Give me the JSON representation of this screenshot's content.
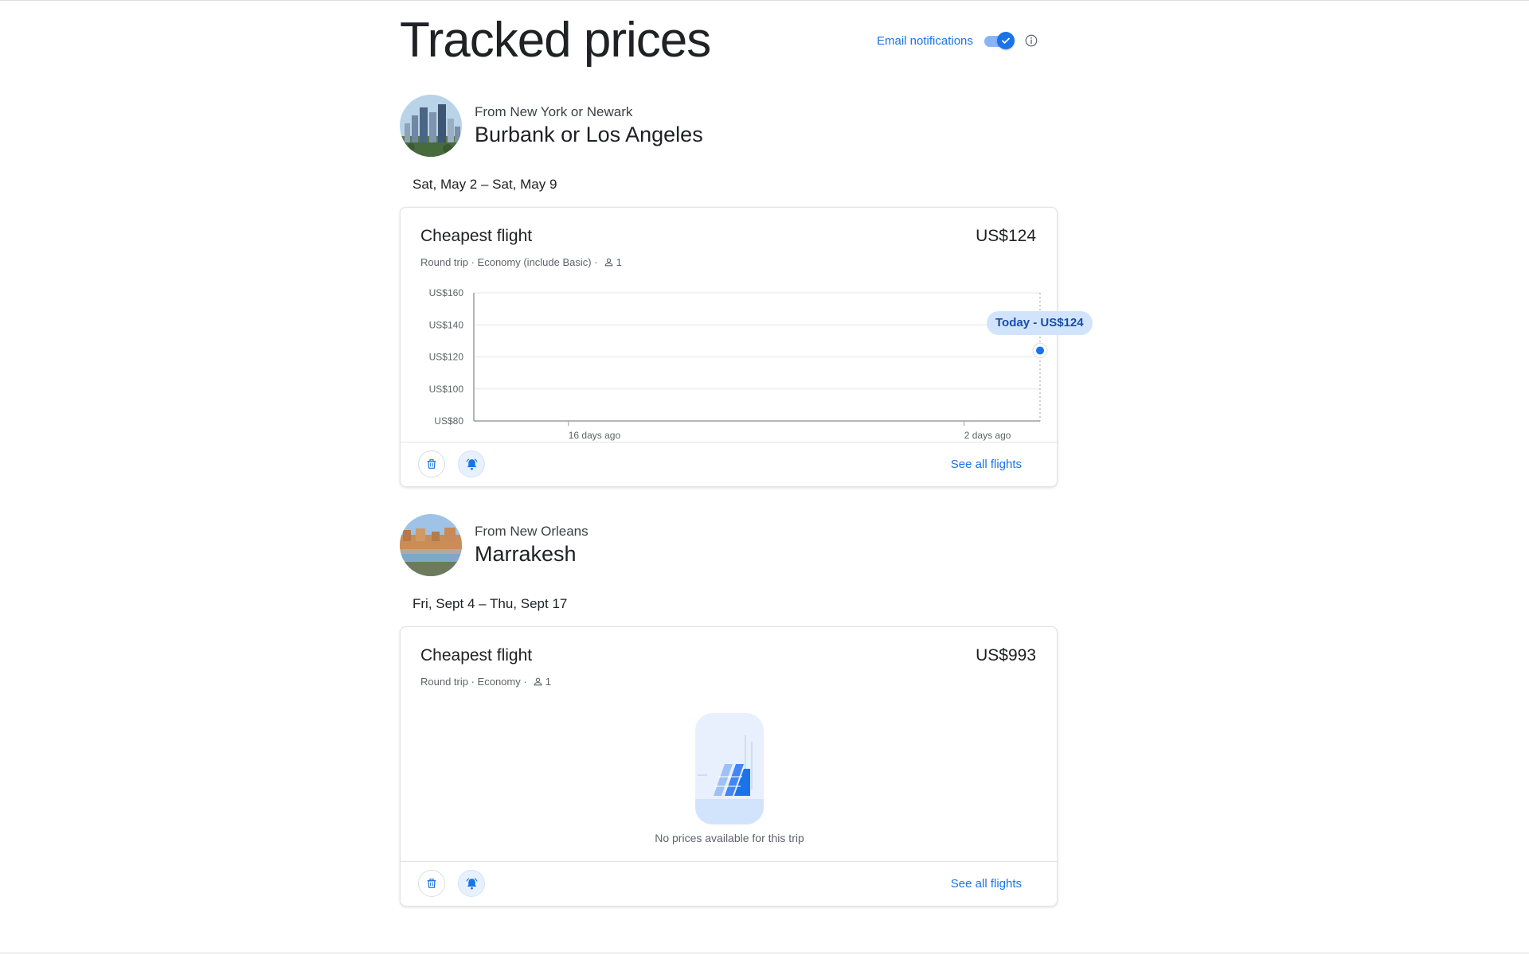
{
  "page": {
    "title": "Tracked prices"
  },
  "email_notifications": {
    "label": "Email notifications",
    "enabled": true
  },
  "colors": {
    "accent": "#1a73e8",
    "accent_light": "#d2e3fc",
    "text": "#202124",
    "muted": "#5f6368"
  },
  "trips": [
    {
      "from": "From New York or Newark",
      "to": "Burbank or Los Angeles",
      "dates": "Sat, May 2 – Sat, May 9",
      "card_title": "Cheapest flight",
      "price": "US$124",
      "trip_type": "Round trip",
      "cabin": "Economy (include Basic)",
      "passengers": "1",
      "see_all": "See all flights",
      "icons": [
        "trash-icon",
        "bell-icon",
        "person-icon"
      ]
    },
    {
      "from": "From New Orleans",
      "to": "Marrakesh",
      "dates": "Fri, Sept 4 – Thu, Sept 17",
      "card_title": "Cheapest flight",
      "price": "US$993",
      "trip_type": "Round trip",
      "cabin": "Economy",
      "passengers": "1",
      "empty_message": "No prices available for this trip",
      "see_all": "See all flights",
      "icons": [
        "trash-icon",
        "bell-icon",
        "person-icon"
      ]
    }
  ],
  "chart_data": {
    "type": "line",
    "title": "",
    "xlabel": "",
    "ylabel": "",
    "ylim": [
      80,
      160
    ],
    "yticks": [
      160,
      140,
      120,
      100,
      80
    ],
    "ytick_labels": [
      "US$160",
      "US$140",
      "US$120",
      "US$100",
      "US$80"
    ],
    "x_tick_labels": [
      "16 days ago",
      "2 days ago"
    ],
    "grid": true,
    "series": [
      {
        "points": [
          {
            "x": "Today",
            "y": 124
          }
        ]
      }
    ],
    "annotation": "Today - US$124"
  }
}
